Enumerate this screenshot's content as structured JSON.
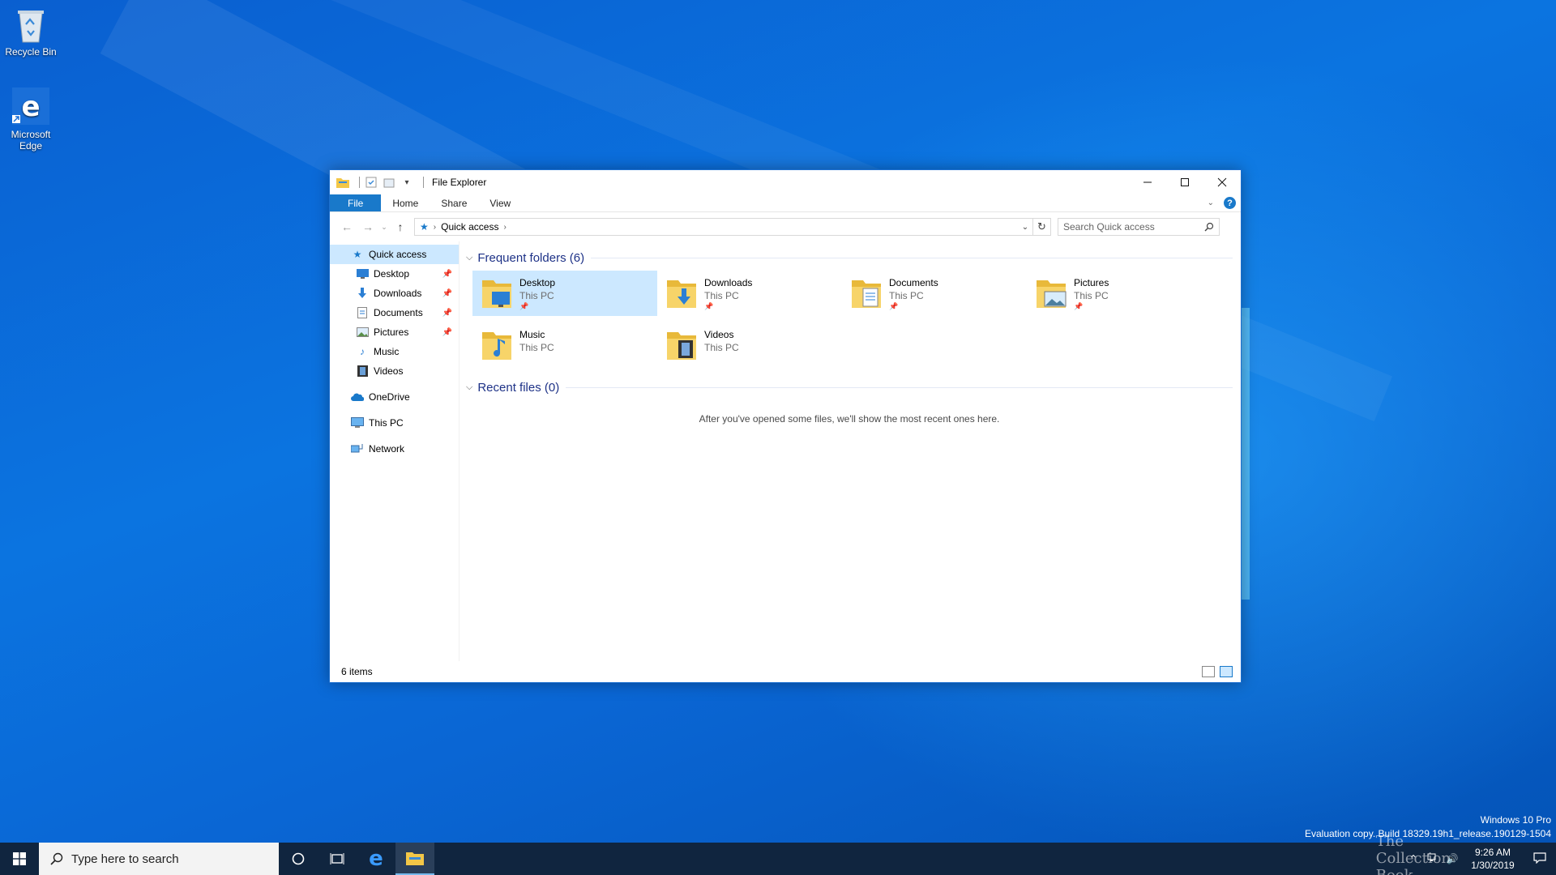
{
  "desktop": {
    "icons": [
      {
        "label": "Recycle Bin",
        "icon": "recycle-bin-icon"
      },
      {
        "label": "Microsoft Edge",
        "icon": "edge-icon"
      }
    ]
  },
  "window": {
    "title": "File Explorer",
    "ribbon_tabs": [
      "File",
      "Home",
      "Share",
      "View"
    ],
    "address": {
      "crumbs": [
        "Quick access"
      ]
    },
    "search": {
      "placeholder": "Search Quick access"
    },
    "nav_pane": {
      "quick_access": "Quick access",
      "pinned": [
        "Desktop",
        "Downloads",
        "Documents",
        "Pictures"
      ],
      "unpinned": [
        "Music",
        "Videos"
      ],
      "onedrive": "OneDrive",
      "this_pc": "This PC",
      "network": "Network"
    },
    "frequent": {
      "heading": "Frequent folders (6)",
      "folders": [
        {
          "name": "Desktop",
          "location": "This PC",
          "pinned": true,
          "icon": "desktop-folder-icon"
        },
        {
          "name": "Downloads",
          "location": "This PC",
          "pinned": true,
          "icon": "downloads-folder-icon"
        },
        {
          "name": "Documents",
          "location": "This PC",
          "pinned": true,
          "icon": "documents-folder-icon"
        },
        {
          "name": "Pictures",
          "location": "This PC",
          "pinned": true,
          "icon": "pictures-folder-icon"
        },
        {
          "name": "Music",
          "location": "This PC",
          "pinned": false,
          "icon": "music-folder-icon"
        },
        {
          "name": "Videos",
          "location": "This PC",
          "pinned": false,
          "icon": "videos-folder-icon"
        }
      ]
    },
    "recent": {
      "heading": "Recent files (0)",
      "empty_message": "After you've opened some files, we'll show the most recent ones here."
    },
    "status": {
      "items": "6 items"
    }
  },
  "watermark": {
    "line1": "Windows 10 Pro",
    "line2": "Evaluation copy. Build 18329.19h1_release.190129-1504"
  },
  "taskbar": {
    "search_placeholder": "Type here to search",
    "clock_time": "9:26 AM",
    "clock_date": "1/30/2019",
    "tray_text": "The Collection Book"
  },
  "colors": {
    "accent": "#1979ca",
    "selection": "#cce8ff",
    "taskbar": "#10253f",
    "heading": "#1e3287"
  }
}
